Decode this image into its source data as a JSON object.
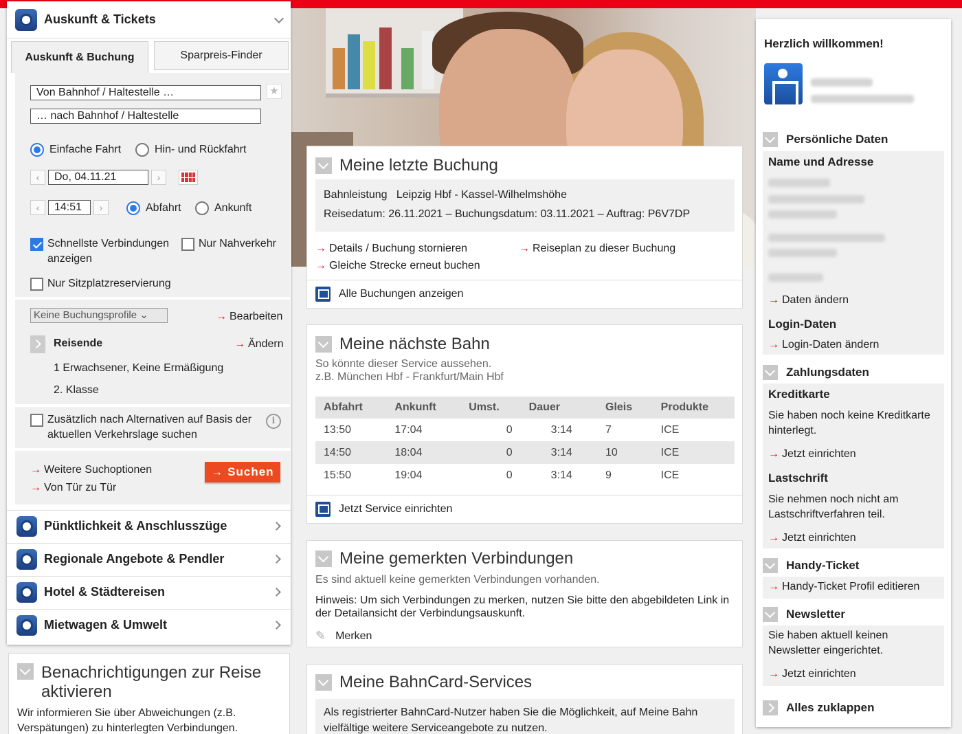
{
  "left": {
    "header": "Auskunft & Tickets",
    "tabs": [
      "Auskunft & Buchung",
      "Sparpreis-Finder"
    ],
    "from_value": "Von Bahnhof / Haltestelle …",
    "to_value": "… nach Bahnhof / Haltestelle",
    "trip_single": "Einfache Fahrt",
    "trip_return": "Hin- und Rückfahrt",
    "date": "Do, 04.11.21",
    "time": "14:51",
    "dep": "Abfahrt",
    "arr": "Ankunft",
    "fastest_1": "Schnellste Verbindungen",
    "fastest_2": "anzeigen",
    "local_only": "Nur Nahverkehr",
    "seat_only": "Nur Sitzplatzreservierung",
    "profile_select": "Keine Buchungsprofile",
    "edit": "Bearbeiten",
    "travellers": "Reisende",
    "change": "Ändern",
    "traveller_info": "1 Erwachsener, Keine Ermäßigung",
    "class": "2. Klasse",
    "alternatives_1": "Zusätzlich nach Alternativen auf Basis der",
    "alternatives_2": "aktuellen Verkehrslage suchen",
    "more_options": "Weitere Suchoptionen",
    "door_to_door": "Von Tür zu Tür",
    "search": "Suchen",
    "accordion": [
      "Pünktlichkeit & Anschlusszüge",
      "Regionale Angebote & Pendler",
      "Hotel & Städtereisen",
      "Mietwagen & Umwelt"
    ]
  },
  "notify": {
    "title_1": "Benachrichtigungen zur Reise",
    "title_2": "aktivieren",
    "text_1": "Wir informieren Sie über Abweichungen (z.B.",
    "text_2": "Verspätungen) zu hinterlegten Verbindungen."
  },
  "last_booking": {
    "title": "Meine letzte Buchung",
    "service": "Bahnleistung",
    "route": "Leipzig Hbf - Kassel-Wilhelmshöhe",
    "details": "Reisedatum: 26.11.2021 – Buchungsdatum: 03.11.2021 – Auftrag: P6V7DP",
    "link_cancel": "Details / Buchung stornieren",
    "link_plan": "Reiseplan zu dieser Buchung",
    "link_again": "Gleiche Strecke erneut buchen",
    "all": "Alle Buchungen anzeigen"
  },
  "next_train": {
    "title": "Meine nächste Bahn",
    "sub_1": "So könnte dieser Service aussehen.",
    "sub_2": "z.B. München Hbf - Frankfurt/Main Hbf",
    "columns": [
      "Abfahrt",
      "Ankunft",
      "Umst.",
      "Dauer",
      "Gleis",
      "Produkte"
    ],
    "rows": [
      [
        "13:50",
        "17:04",
        "0",
        "3:14",
        "7",
        "ICE"
      ],
      [
        "14:50",
        "18:04",
        "0",
        "3:14",
        "10",
        "ICE"
      ],
      [
        "15:50",
        "19:04",
        "0",
        "3:14",
        "9",
        "ICE"
      ]
    ],
    "setup": "Jetzt Service einrichten"
  },
  "saved": {
    "title": "Meine gemerkten Verbindungen",
    "sub": "Es sind aktuell keine gemerkten Verbindungen vorhanden.",
    "hint_1": "Hinweis: Um sich Verbindungen zu merken, nutzen Sie bitte den abgebildeten Link in",
    "hint_2": "der Detailansicht der Verbindungsauskunft.",
    "remember": "Merken"
  },
  "bahncard": {
    "title": "Meine BahnCard-Services",
    "text_1": "Als registrierter BahnCard-Nutzer haben Sie die Möglichkeit, auf Meine Bahn",
    "text_2": "vielfältige weitere Serviceangebote zu nutzen."
  },
  "right": {
    "welcome": "Herzlich willkommen!",
    "personal": "Persönliche Daten",
    "name_addr": "Name und Adresse",
    "change_data": "Daten ändern",
    "login": "Login-Daten",
    "change_login": "Login-Daten ändern",
    "payment": "Zahlungsdaten",
    "credit": "Kreditkarte",
    "credit_text_1": "Sie haben noch keine Kreditkarte",
    "credit_text_2": "hinterlegt.",
    "setup_now": "Jetzt einrichten",
    "debit": "Lastschrift",
    "debit_text_1": "Sie nehmen noch nicht am",
    "debit_text_2": "Lastschriftverfahren teil.",
    "handy": "Handy-Ticket",
    "handy_edit": "Handy-Ticket Profil editieren",
    "newsletter": "Newsletter",
    "news_text_1": "Sie haben aktuell keinen",
    "news_text_2": "Newsletter eingerichtet.",
    "collapse_all": "Alles zuklappen"
  }
}
